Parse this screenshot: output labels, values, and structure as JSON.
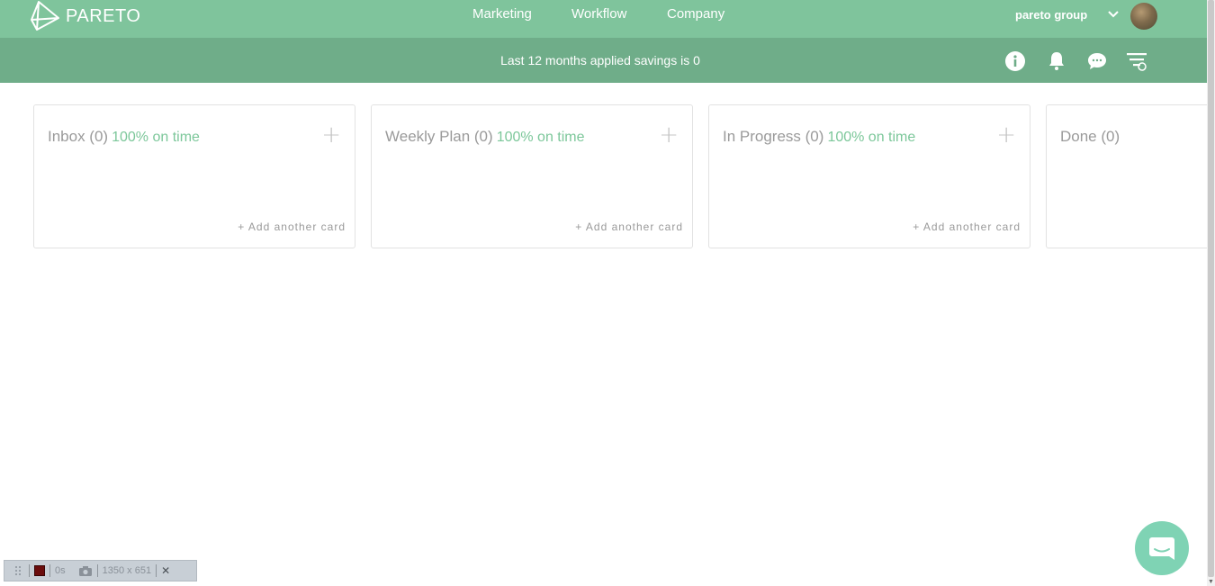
{
  "header": {
    "logo_text": "PARETO",
    "nav": [
      "Marketing",
      "Workflow",
      "Company"
    ],
    "account_name": "pareto group",
    "accent_color": "#7fc49c"
  },
  "subheader": {
    "savings_text": "Last 12 months applied savings is 0",
    "icons": [
      "info-icon",
      "bell-icon",
      "chat-bubble-icon",
      "filter-icon"
    ],
    "background_color": "#6fad89"
  },
  "board": {
    "columns": [
      {
        "title": "Inbox (0)",
        "on_time": "100% on time",
        "add_label": "+ Add another card"
      },
      {
        "title": "Weekly Plan (0)",
        "on_time": "100% on time",
        "add_label": "+ Add another card"
      },
      {
        "title": "In Progress (0)",
        "on_time": "100% on time",
        "add_label": "+ Add another card"
      },
      {
        "title": "Done (0)"
      }
    ],
    "plus_glyph": "+"
  },
  "recorder": {
    "timer": "0s",
    "resolution": "1350 x 651",
    "close": "✕"
  }
}
